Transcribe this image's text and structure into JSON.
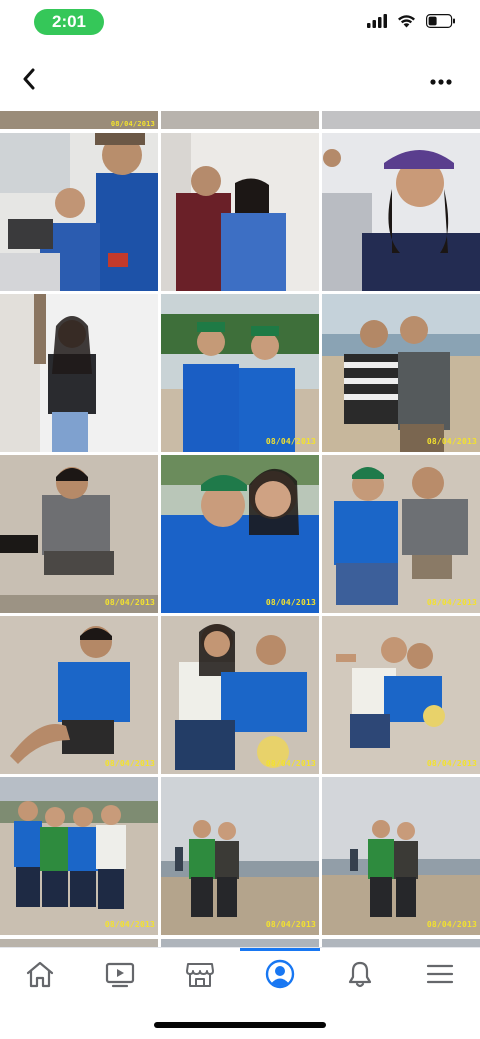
{
  "status_bar": {
    "time": "2:01",
    "icons": [
      "signal-icon",
      "wifi-icon",
      "battery-icon"
    ],
    "pill_color": "#35c759"
  },
  "nav": {
    "back_icon": "chevron-left-icon",
    "more_icon": "more-horizontal-icon"
  },
  "photos": {
    "date_stamp": "08/04/2013",
    "stamp_color": "#f3e22e",
    "tiles": [
      {
        "scene": "classroom-laptop",
        "stamp": ""
      },
      {
        "scene": "hallway-pair",
        "stamp": ""
      },
      {
        "scene": "classroom-cap",
        "stamp": ""
      },
      {
        "scene": "white-wall-portrait",
        "stamp": ""
      },
      {
        "scene": "palm-beach-pair",
        "stamp": "08/04/2013"
      },
      {
        "scene": "seaside-pair",
        "stamp": "08/04/2013"
      },
      {
        "scene": "sand-sitting",
        "stamp": "08/04/2013"
      },
      {
        "scene": "selfie-caps",
        "stamp": "08/04/2013"
      },
      {
        "scene": "sand-pair-sitting",
        "stamp": "08/04/2013"
      },
      {
        "scene": "sand-reclining",
        "stamp": "08/04/2013"
      },
      {
        "scene": "sand-pair-ball",
        "stamp": "08/04/2013"
      },
      {
        "scene": "sand-pair-ball-wide",
        "stamp": "08/04/2013"
      },
      {
        "scene": "group-four",
        "stamp": "08/04/2013"
      },
      {
        "scene": "overcast-beach-pair",
        "stamp": "08/04/2013"
      },
      {
        "scene": "overcast-beach-pair-2",
        "stamp": "08/04/2013"
      }
    ]
  },
  "tab_bar": {
    "active_color": "#1877f2",
    "tabs": [
      {
        "icon": "home-icon",
        "active": false
      },
      {
        "icon": "video-icon",
        "active": false
      },
      {
        "icon": "marketplace-icon",
        "active": false
      },
      {
        "icon": "profile-icon",
        "active": true
      },
      {
        "icon": "bell-icon",
        "active": false
      },
      {
        "icon": "menu-icon",
        "active": false
      }
    ]
  }
}
